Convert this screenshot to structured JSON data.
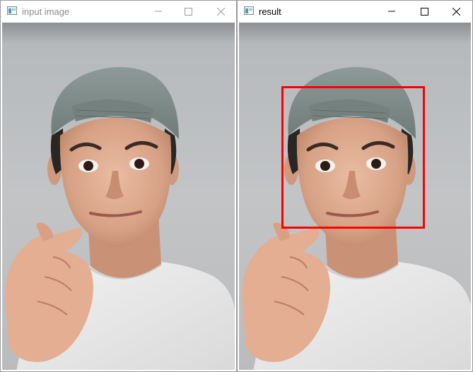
{
  "windows": [
    {
      "title": "input image",
      "active": false,
      "icon": "opencv-window-icon",
      "controls": [
        "minimize-icon",
        "maximize-icon",
        "close-icon"
      ],
      "image_description": "selfie photo of a man wearing a grey cap backwards and a white t-shirt, making a finger heart gesture"
    },
    {
      "title": "result",
      "active": true,
      "icon": "opencv-window-icon",
      "controls": [
        "minimize-icon",
        "maximize-icon",
        "close-icon"
      ],
      "image_description": "same selfie photo with a detected face bounding box",
      "detection": {
        "label": "face",
        "box_color": "#ff0000"
      }
    }
  ],
  "colors": {
    "inactive_title": "#8c8c8c",
    "active_title": "#000000",
    "window_border": "#9a9a9a"
  }
}
